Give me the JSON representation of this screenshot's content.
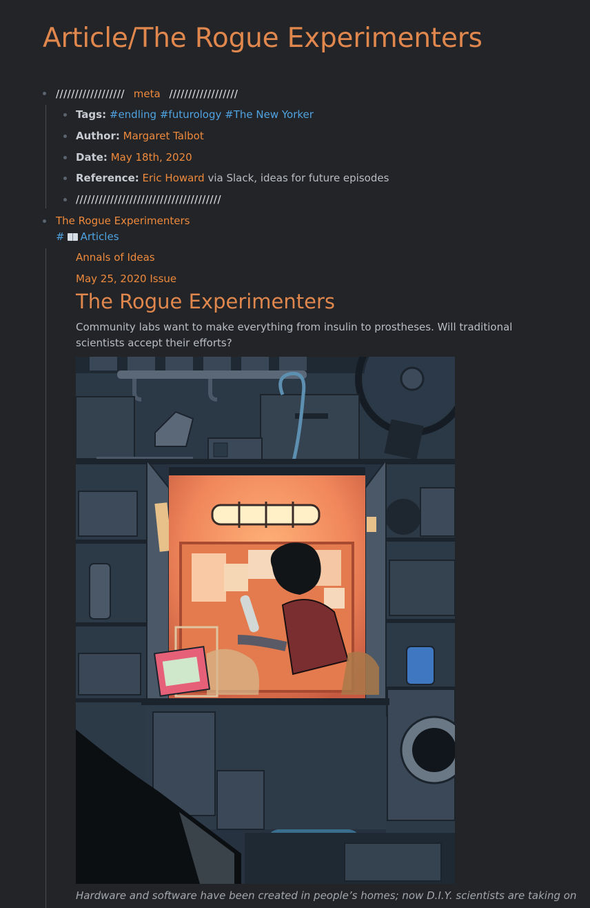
{
  "page": {
    "title": "Article/The Rogue Experimenters"
  },
  "meta": {
    "header_slashes_left": "//////////////////",
    "header_label": "meta",
    "header_slashes_right": "//////////////////",
    "tags_label": "Tags:",
    "tags": [
      "#endling",
      "#futurology",
      "#The New Yorker"
    ],
    "author_label": "Author:",
    "author": "Margaret Talbot",
    "date_label": "Date:",
    "date": "May 18th, 2020",
    "reference_label": "Reference:",
    "reference_link": "Eric Howard",
    "reference_rest": "via Slack, ideas for future episodes",
    "footer_slashes": "//////////////////////////////////////"
  },
  "article": {
    "link_title": "The Rogue Experimenters",
    "tag_hash": "#",
    "tag_icon": "book-icon",
    "tag_label": "Articles",
    "section": "Annals of Ideas",
    "issue": "May 25, 2020 Issue",
    "heading": "The Rogue Experimenters",
    "description": "Community labs want to make everything from insulin to prostheses. Will traditional scientists accept their efforts?",
    "image_alt": "Illustration of a person working in a glowing home lab inside a garage",
    "caption": "Hardware and software have been created in people’s homes; now D.I.Y. scientists are taking on"
  },
  "colors": {
    "background": "#232427",
    "accent_orange": "#ef8a3c",
    "title_orange": "#e0874e",
    "link_blue": "#4fa3e0"
  }
}
